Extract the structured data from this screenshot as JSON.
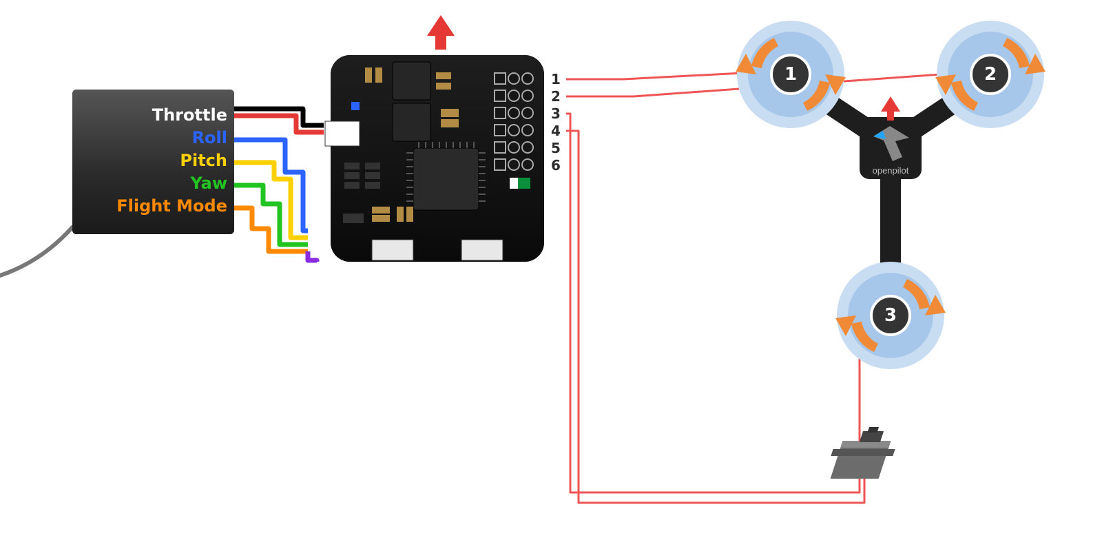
{
  "receiver": {
    "channels": [
      {
        "label": "Throttle",
        "color": "#ffffff"
      },
      {
        "label": "Roll",
        "color": "#2a63ff"
      },
      {
        "label": "Pitch",
        "color": "#ffd000"
      },
      {
        "label": "Yaw",
        "color": "#22c421"
      },
      {
        "label": "Flight Mode",
        "color": "#ff8a00"
      }
    ]
  },
  "flight_controller": {
    "output_pins": [
      "1",
      "2",
      "3",
      "4",
      "5",
      "6"
    ]
  },
  "tricopter": {
    "brand": "openpilot",
    "motors": [
      {
        "id": "1"
      },
      {
        "id": "2"
      },
      {
        "id": "3"
      }
    ]
  }
}
